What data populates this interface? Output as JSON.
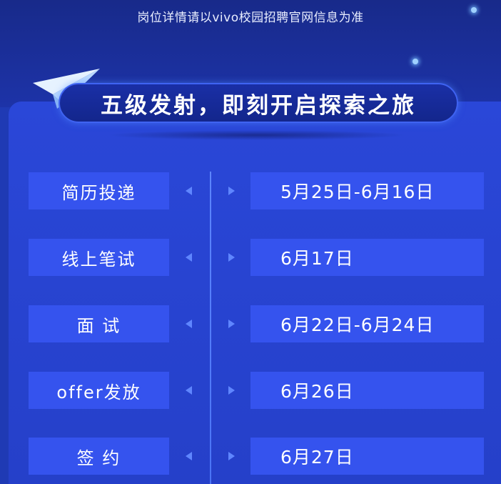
{
  "notice": "岗位详情请以vivo校园招聘官网信息为准",
  "title": "五级发射，即刻开启探索之旅",
  "stages": [
    {
      "label": "简历投递",
      "date": "5月25日-6月16日"
    },
    {
      "label": "线上笔试",
      "date": "6月17日"
    },
    {
      "label": "面 试",
      "date": "6月22日-6月24日"
    },
    {
      "label": "offer发放",
      "date": "6月26日"
    },
    {
      "label": "签 约",
      "date": "6月27日"
    }
  ],
  "icons": {
    "plane": "paper-plane-icon",
    "arrow_left": "arrow-left-icon",
    "arrow_right": "arrow-right-icon"
  },
  "colors": {
    "background": "#1f3ab4",
    "panel": "#2a47d8",
    "box": "#3553ee",
    "text": "#ffffff",
    "accent": "#5f86ff"
  }
}
